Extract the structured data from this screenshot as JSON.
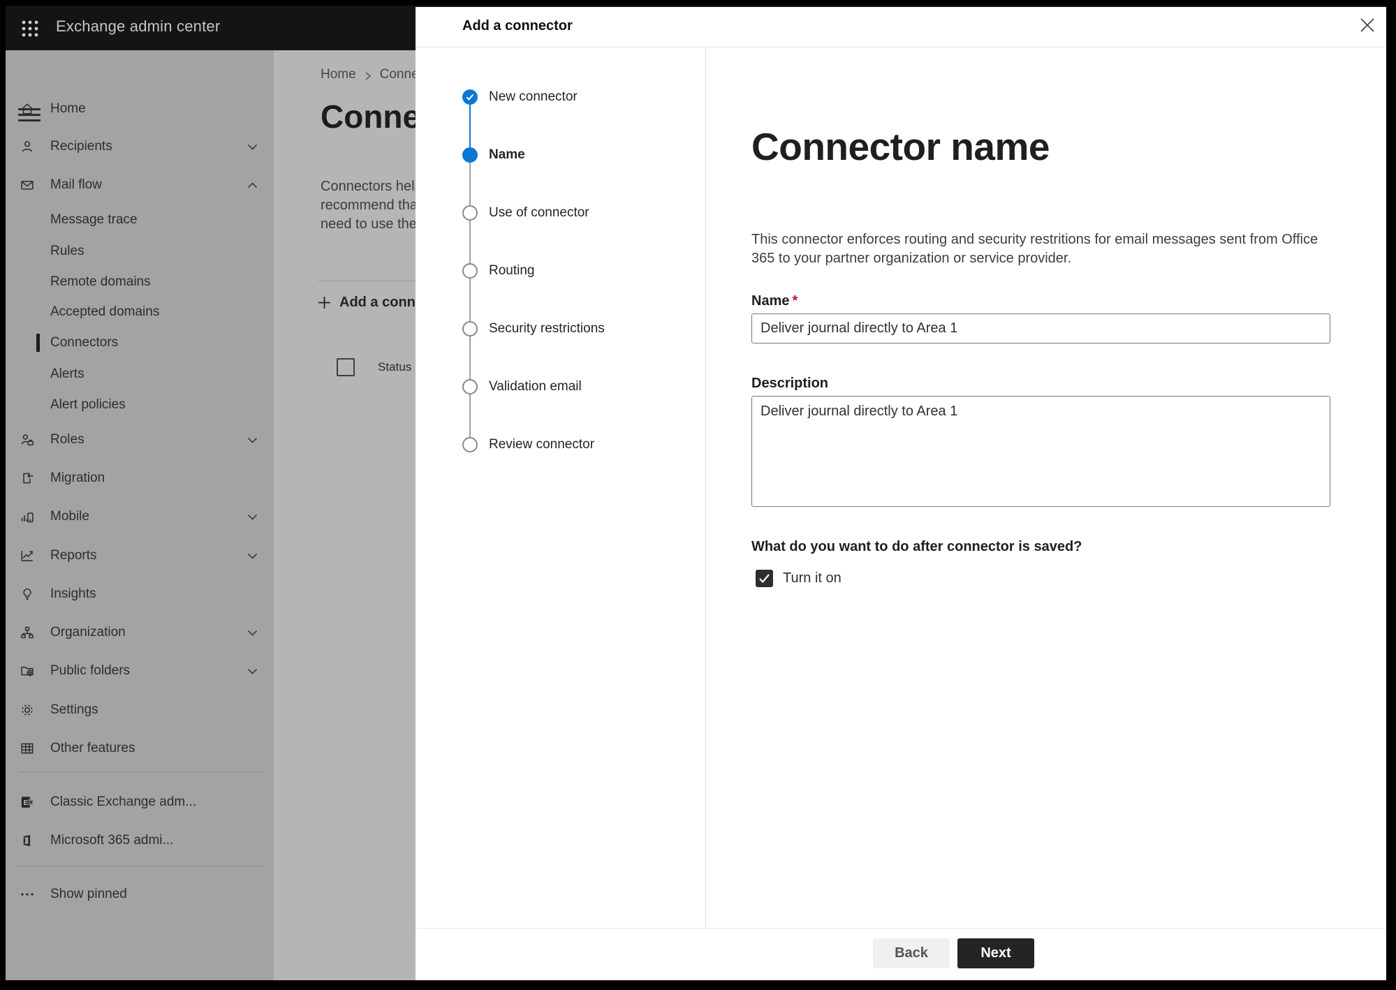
{
  "topbar": {
    "title": "Exchange admin center"
  },
  "sidebar": {
    "items": [
      {
        "label": "Home",
        "icon": "home"
      },
      {
        "label": "Recipients",
        "icon": "person",
        "chevron": "down"
      },
      {
        "label": "Mail flow",
        "icon": "mail",
        "chevron": "up"
      },
      {
        "label": "Message trace",
        "indent": true
      },
      {
        "label": "Rules",
        "indent": true
      },
      {
        "label": "Remote domains",
        "indent": true
      },
      {
        "label": "Accepted domains",
        "indent": true
      },
      {
        "label": "Connectors",
        "indent": true,
        "selected": true
      },
      {
        "label": "Alerts",
        "indent": true
      },
      {
        "label": "Alert policies",
        "indent": true
      },
      {
        "label": "Roles",
        "icon": "roles",
        "chevron": "down"
      },
      {
        "label": "Migration",
        "icon": "migration"
      },
      {
        "label": "Mobile",
        "icon": "mobile",
        "chevron": "down"
      },
      {
        "label": "Reports",
        "icon": "reports",
        "chevron": "down"
      },
      {
        "label": "Insights",
        "icon": "insights"
      },
      {
        "label": "Organization",
        "icon": "organization",
        "chevron": "down"
      },
      {
        "label": "Public folders",
        "icon": "folders",
        "chevron": "down"
      },
      {
        "label": "Settings",
        "icon": "settings"
      },
      {
        "label": "Other features",
        "icon": "grid"
      }
    ],
    "footer_items": [
      {
        "label": "Classic Exchange adm...",
        "icon": "exchange"
      },
      {
        "label": "Microsoft 365 admi...",
        "icon": "office"
      }
    ],
    "show_pinned": {
      "label": "Show pinned",
      "icon": "dots"
    }
  },
  "page": {
    "breadcrumb": {
      "home": "Home",
      "current": "Conne"
    },
    "title": "Connect",
    "paragraph_lines": [
      "Connectors help",
      "recommend that",
      "need to use ther"
    ],
    "add_button_label": "Add a conn",
    "status_header": "Status"
  },
  "modal": {
    "title": "Add a connector",
    "steps": [
      {
        "label": "New connector",
        "state": "completed"
      },
      {
        "label": "Name",
        "state": "active"
      },
      {
        "label": "Use of connector",
        "state": "upcoming"
      },
      {
        "label": "Routing",
        "state": "upcoming"
      },
      {
        "label": "Security restrictions",
        "state": "upcoming"
      },
      {
        "label": "Validation email",
        "state": "upcoming"
      },
      {
        "label": "Review connector",
        "state": "upcoming"
      }
    ],
    "content": {
      "heading": "Connector name",
      "description": "This connector enforces routing and security restritions for email messages sent from Office 365 to your partner organization or service provider.",
      "name_label": "Name",
      "required_marker": "*",
      "name_value": "Deliver journal directly to Area 1",
      "description_label": "Description",
      "description_value": "Deliver journal directly to Area 1",
      "after_save_question": "What do you want to do after connector is saved?",
      "turn_on_label": "Turn it on",
      "turn_on_checked": true
    },
    "footer": {
      "back_label": "Back",
      "next_label": "Next"
    }
  },
  "colors": {
    "accent_blue": "#0b79d4",
    "topbar_bg": "#141414",
    "sidebar_dimmed_bg": "#a3a3a3",
    "page_dimmed_bg": "#b5b5b5",
    "modal_bg": "#ffffff",
    "required_red": "#c50f1f",
    "primary_button_bg": "#252423",
    "checkbox_checked_bg": "#2e2d2c"
  }
}
